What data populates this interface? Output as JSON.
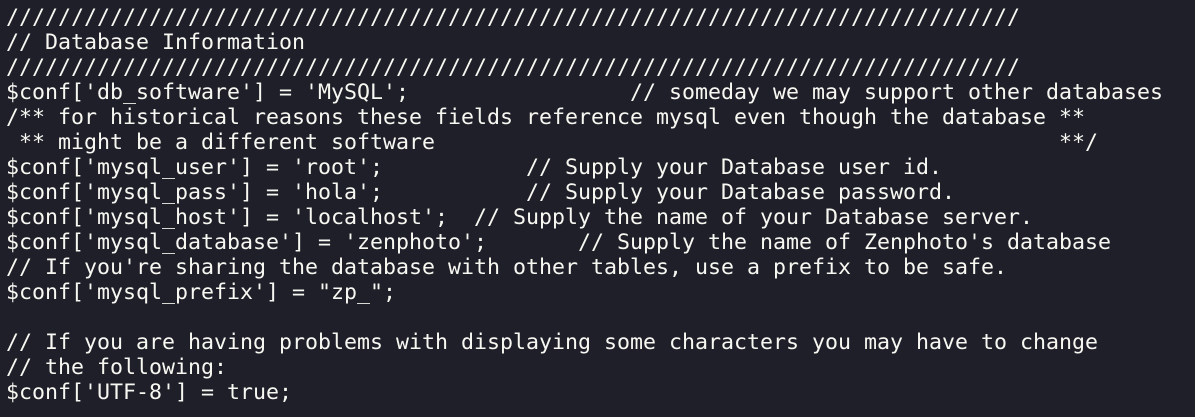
{
  "terminal": {
    "lines": [
      "//////////////////////////////////////////////////////////////////////////////",
      "// Database Information",
      "//////////////////////////////////////////////////////////////////////////////",
      "$conf['db_software'] = 'MySQL';                 // someday we may support other databases",
      "/** for historical reasons these fields reference mysql even though the database **",
      " ** might be a different software                                                **/",
      "$conf['mysql_user'] = 'root';           // Supply your Database user id.",
      "$conf['mysql_pass'] = 'hola';           // Supply your Database password.",
      "$conf['mysql_host'] = 'localhost';  // Supply the name of your Database server.",
      "$conf['mysql_database'] = 'zenphoto';       // Supply the name of Zenphoto's database",
      "// If you're sharing the database with other tables, use a prefix to be safe.",
      "$conf['mysql_prefix'] = \"zp_\";",
      "",
      "// If you are having problems with displaying some characters you may have to change",
      "// the following:",
      "$conf['UTF-8'] = true;"
    ]
  }
}
